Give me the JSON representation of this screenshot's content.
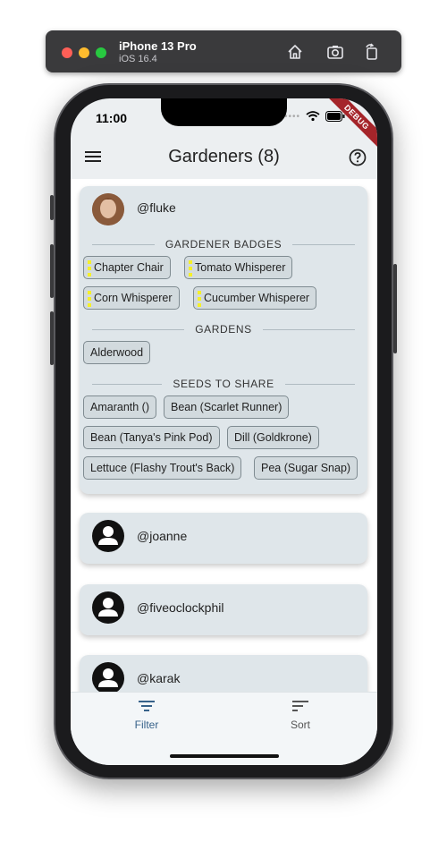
{
  "simulator": {
    "device": "iPhone 13 Pro",
    "os": "iOS 16.4",
    "icons": [
      "home-icon",
      "screenshot-icon",
      "rotate-icon"
    ]
  },
  "status_bar": {
    "time": "11:00",
    "debug_label": "DEBUG"
  },
  "appbar": {
    "title": "Gardeners (8)",
    "icons": [
      "menu-icon",
      "help-icon"
    ]
  },
  "sections": {
    "badges": "GARDENER BADGES",
    "gardens": "GARDENS",
    "seeds": "SEEDS TO SHARE"
  },
  "gardeners": [
    {
      "handle": "@fluke",
      "badges": [
        "Chapter Chair",
        "Tomato Whisperer",
        "Corn Whisperer",
        "Cucumber Whisperer"
      ],
      "gardens": [
        "Alderwood"
      ],
      "seeds": [
        "Amaranth ()",
        "Bean (Scarlet Runner)",
        "Bean (Tanya's Pink Pod)",
        "Dill (Goldkrone)",
        "Lettuce (Flashy Trout's Back)",
        "Pea (Sugar Snap)"
      ]
    },
    {
      "handle": "@joanne"
    },
    {
      "handle": "@fiveoclockphil"
    },
    {
      "handle": "@karak"
    }
  ],
  "bottom_nav": {
    "filter_label": "Filter",
    "sort_label": "Sort",
    "active": "Filter",
    "active_color": "#37628a",
    "inactive_color": "#555555"
  }
}
